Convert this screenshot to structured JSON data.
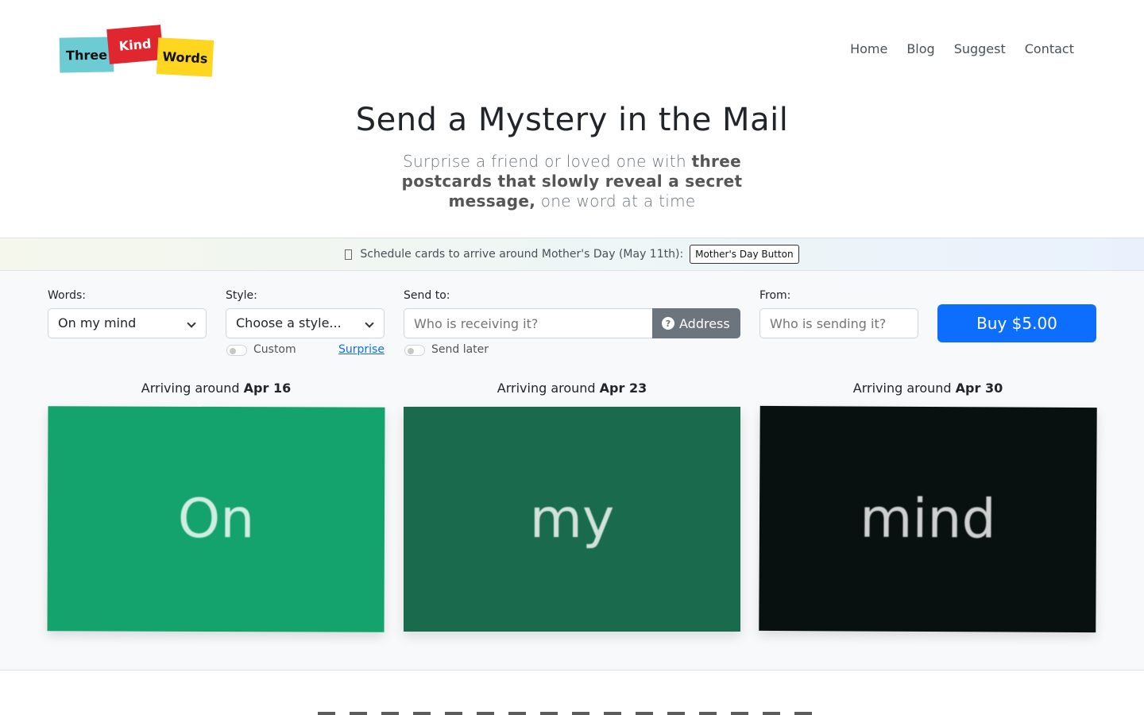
{
  "logo": {
    "word1": "Three",
    "word2": "Kind",
    "word3": "Words"
  },
  "nav": {
    "home": "Home",
    "blog": "Blog",
    "suggest": "Suggest",
    "contact": "Contact"
  },
  "hero": {
    "title": "Send a Mystery in the Mail",
    "subtitle_pre": "Surprise a friend or loved one with ",
    "subtitle_bold": "three postcards that slowly reveal a secret message,",
    "subtitle_post": " one word at a time"
  },
  "banner": {
    "text": "Schedule cards to arrive around Mother's Day (May 11th):",
    "button": "Mother's Day Button"
  },
  "form": {
    "words_label": "Words:",
    "words_value": "On my mind",
    "style_label": "Style:",
    "style_value": "Choose a style...",
    "custom_label": "Custom",
    "surprise_label": "Surprise",
    "sendto_label": "Send to:",
    "sendto_placeholder": "Who is receiving it?",
    "address_button": "Address",
    "send_later_label": "Send later",
    "from_label": "From:",
    "from_placeholder": "Who is sending it?",
    "buy_button": "Buy $5.00"
  },
  "cards": [
    {
      "arriving_prefix": "Arriving around ",
      "date": "Apr 16",
      "word": "On",
      "color": "#14a36c"
    },
    {
      "arriving_prefix": "Arriving around ",
      "date": "Apr 23",
      "word": "my",
      "color": "#1a6b4d"
    },
    {
      "arriving_prefix": "Arriving around ",
      "date": "Apr 30",
      "word": "mind",
      "color": "#08110f"
    }
  ]
}
